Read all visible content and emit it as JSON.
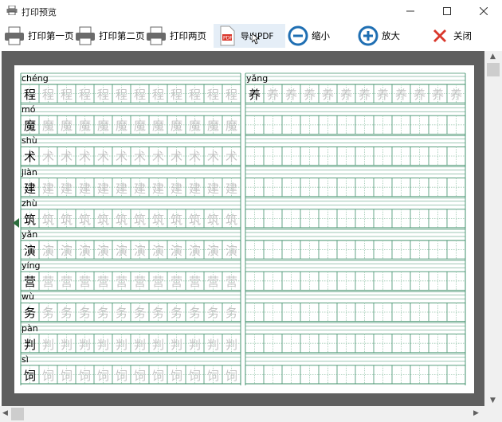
{
  "window": {
    "title": "打印预览"
  },
  "toolbar": {
    "print_first": "打印第一页",
    "print_second": "打印第二页",
    "print_both": "打印两页",
    "export_pdf": "导出PDF",
    "zoom_out": "缩小",
    "zoom_in": "放大",
    "close": "关闭"
  },
  "colors": {
    "grid": "#3f8f6a",
    "trace": "#c4c4c4",
    "viewport_bg": "#5f5f5f",
    "accent_blue": "#1f6fb3",
    "close_red": "#d9372b"
  },
  "sheet": {
    "left_column": [
      {
        "pinyin": "chéng",
        "char": "程"
      },
      {
        "pinyin": "mó",
        "char": "魔"
      },
      {
        "pinyin": "shù",
        "char": "术"
      },
      {
        "pinyin": "jiàn",
        "char": "建"
      },
      {
        "pinyin": "zhù",
        "char": "筑"
      },
      {
        "pinyin": "yǎn",
        "char": "演"
      },
      {
        "pinyin": "yíng",
        "char": "营"
      },
      {
        "pinyin": "wù",
        "char": "务"
      },
      {
        "pinyin": "pàn",
        "char": "判"
      },
      {
        "pinyin": "sì",
        "char": "饲"
      }
    ],
    "right_column": [
      {
        "pinyin": "yǎng",
        "char": "养"
      }
    ]
  }
}
